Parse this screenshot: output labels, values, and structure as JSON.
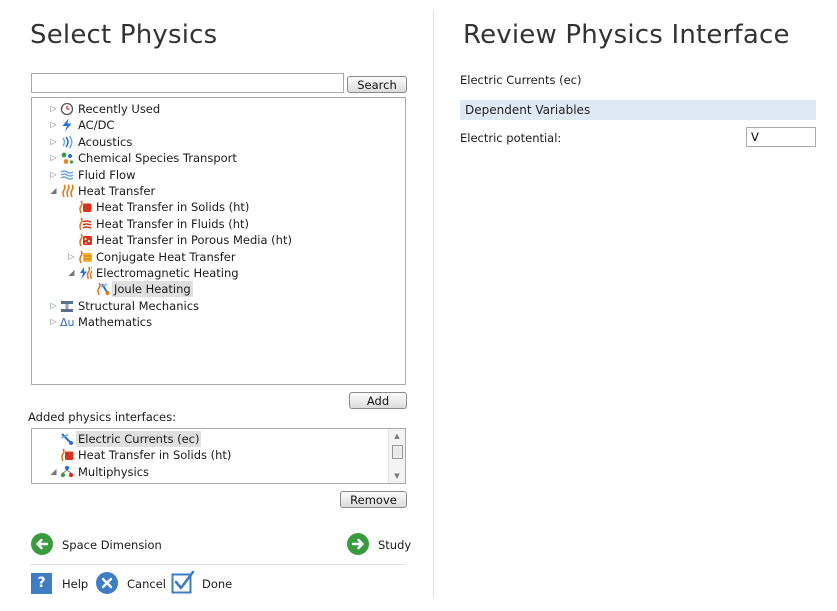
{
  "left": {
    "title": "Select Physics",
    "search": {
      "value": "",
      "button_label": "Search"
    },
    "tree": [
      {
        "label": "Recently Used",
        "icon": "clock-icon",
        "expander": "collapsed",
        "depth": 0
      },
      {
        "label": "AC/DC",
        "icon": "acdc-icon",
        "expander": "collapsed",
        "depth": 0
      },
      {
        "label": "Acoustics",
        "icon": "acoustics-icon",
        "expander": "collapsed",
        "depth": 0
      },
      {
        "label": "Chemical Species Transport",
        "icon": "chemical-species-icon",
        "expander": "collapsed",
        "depth": 0
      },
      {
        "label": "Fluid Flow",
        "icon": "fluid-flow-icon",
        "expander": "collapsed",
        "depth": 0
      },
      {
        "label": "Heat Transfer",
        "icon": "heat-transfer-icon",
        "expander": "expanded",
        "depth": 0
      },
      {
        "label": "Heat Transfer in Solids (ht)",
        "icon": "heat-solids-icon",
        "expander": "none",
        "depth": 1
      },
      {
        "label": "Heat Transfer in Fluids (ht)",
        "icon": "heat-fluids-icon",
        "expander": "none",
        "depth": 1
      },
      {
        "label": "Heat Transfer in Porous Media (ht)",
        "icon": "heat-porous-icon",
        "expander": "none",
        "depth": 1
      },
      {
        "label": "Conjugate Heat Transfer",
        "icon": "conjugate-heat-icon",
        "expander": "collapsed",
        "depth": 1
      },
      {
        "label": "Electromagnetic Heating",
        "icon": "em-heating-icon",
        "expander": "expanded",
        "depth": 1
      },
      {
        "label": "Joule Heating",
        "icon": "joule-heating-icon",
        "expander": "none",
        "depth": 2,
        "selected": true
      },
      {
        "label": "Structural Mechanics",
        "icon": "structural-mechanics-icon",
        "expander": "collapsed",
        "depth": 0
      },
      {
        "label": "Mathematics",
        "icon": "mathematics-icon",
        "expander": "collapsed",
        "depth": 0
      }
    ],
    "add_label": "Add",
    "added_heading": "Added physics interfaces:",
    "added": [
      {
        "label": "Electric Currents (ec)",
        "icon": "electric-currents-icon",
        "expander": "none",
        "selected": true
      },
      {
        "label": "Heat Transfer in Solids (ht)",
        "icon": "heat-solids-icon",
        "expander": "none"
      },
      {
        "label": "Multiphysics",
        "icon": "multiphysics-icon",
        "expander": "expanded"
      }
    ],
    "remove_label": "Remove",
    "nav": {
      "back_label": "Space Dimension",
      "next_label": "Study"
    },
    "footer": {
      "help_label": "Help",
      "cancel_label": "Cancel",
      "done_label": "Done"
    }
  },
  "right": {
    "title": "Review Physics Interface",
    "interface_name": "Electric Currents (ec)",
    "section_header": "Dependent Variables",
    "field_label": "Electric potential:",
    "field_value": "V"
  },
  "colors": {
    "accent_blue": "#3c7dc4",
    "nav_green": "#3a9b3e",
    "section_bg": "#dfe9f5"
  }
}
